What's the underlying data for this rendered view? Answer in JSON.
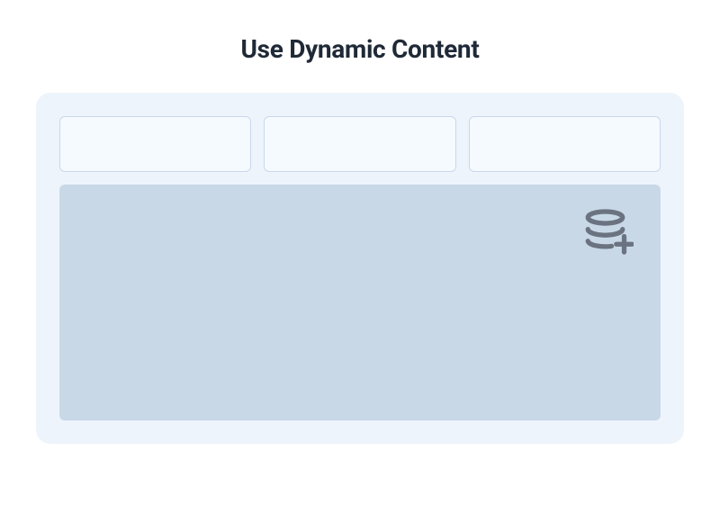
{
  "title": "Use Dynamic Content",
  "panel": {
    "cards": [
      "",
      "",
      ""
    ],
    "icon_name": "database-plus-icon"
  }
}
